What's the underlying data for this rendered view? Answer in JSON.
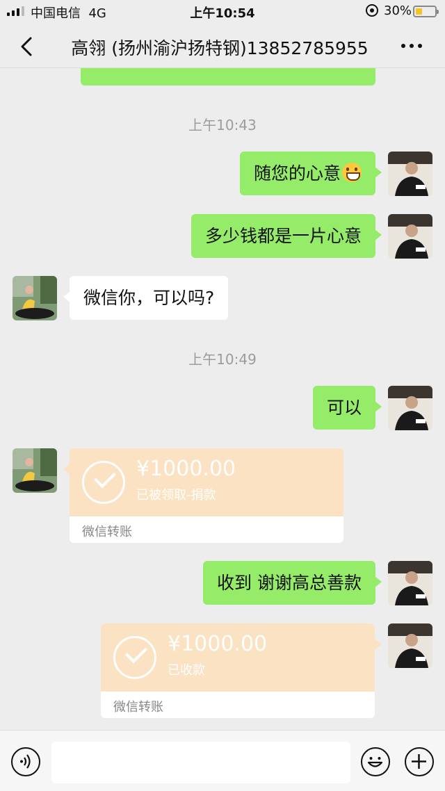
{
  "status_bar": {
    "carrier": "中国电信",
    "network": "4G",
    "time": "上午10:54",
    "battery": "30%"
  },
  "nav": {
    "title": "高翎 (扬州渝沪扬特钢)13852785955",
    "back_icon": "chevron-left-icon",
    "more_icon": "more-dots-icon"
  },
  "chat": {
    "timestamps": [
      "上午10:43",
      "上午10:49"
    ],
    "messages": [
      {
        "side": "out",
        "text": "随您的心意",
        "emoji": "grinning-face-icon"
      },
      {
        "side": "out",
        "text": "多少钱都是一片心意"
      },
      {
        "side": "in",
        "text": "微信你，可以吗?"
      },
      {
        "side": "out",
        "text": "可以"
      },
      {
        "side": "out",
        "text": "收到 谢谢高总善款"
      }
    ],
    "transfers": [
      {
        "side": "in",
        "amount": "¥1000.00",
        "note": "已被领取-捐款",
        "label": "微信转账"
      },
      {
        "side": "out",
        "amount": "¥1000.00",
        "note": "已收款",
        "label": "微信转账"
      }
    ]
  },
  "colors": {
    "outgoing_bubble": "#95ec69",
    "incoming_bubble": "#ffffff",
    "transfer_card": "#fbe2c3",
    "background": "#ededed"
  },
  "input_bar": {
    "voice_icon": "voice-icon",
    "emoji_icon": "emoji-icon",
    "plus_icon": "plus-icon"
  }
}
